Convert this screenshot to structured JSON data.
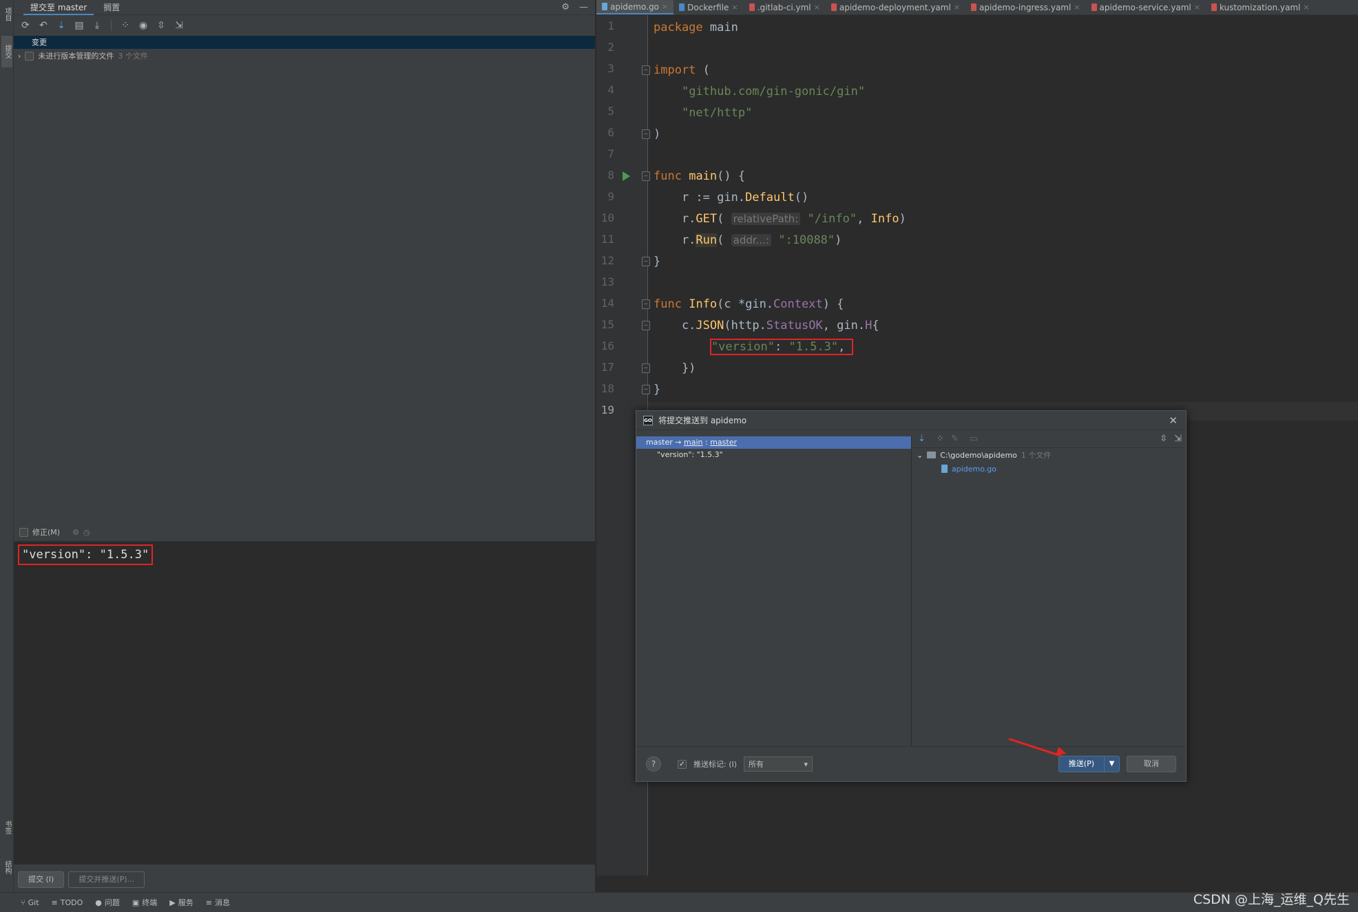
{
  "left_strip": {
    "top_tab": "项目",
    "commit_tab": "提交",
    "bookmarks_tab": "书签",
    "structure_tab": "结构"
  },
  "commit_panel": {
    "tabs": [
      "提交至 master",
      "搁置"
    ],
    "changes_header": "变更",
    "unversioned_label": "未进行版本管理的文件",
    "unversioned_count": "3 个文件",
    "amend_label": "修正(M)",
    "message": "\"version\": \"1.5.3\"",
    "commit_button": "提交 (I)",
    "commit_push_button": "提交并推送(P)..."
  },
  "editor": {
    "tabs": [
      {
        "label": "apidemo.go",
        "active": true
      },
      {
        "label": "Dockerfile",
        "active": false
      },
      {
        "label": ".gitlab-ci.yml",
        "active": false
      },
      {
        "label": "apidemo-deployment.yaml",
        "active": false
      },
      {
        "label": "apidemo-ingress.yaml",
        "active": false
      },
      {
        "label": "apidemo-service.yaml",
        "active": false
      },
      {
        "label": "kustomization.yaml",
        "active": false
      }
    ],
    "line_numbers": [
      "1",
      "2",
      "3",
      "4",
      "5",
      "6",
      "7",
      "8",
      "9",
      "10",
      "11",
      "12",
      "13",
      "14",
      "15",
      "16",
      "17",
      "18",
      "19"
    ],
    "hints": {
      "relative_path": "relativePath:",
      "addr": "addr...:"
    }
  },
  "dialog": {
    "title": "将提交推送到 apidemo",
    "branch_source": "master",
    "branch_arrow": "→",
    "branch_remote": "main",
    "branch_sep": ":",
    "branch_target": "master",
    "commit_message": "\"version\": \"1.5.3\"",
    "repo_path": "C:\\godemo\\apidemo",
    "repo_file_count": "1 个文件",
    "file": "apidemo.go",
    "push_tags_label": "推送标记: (I)",
    "push_tags_value": "所有",
    "push_button": "推送(P)",
    "cancel_button": "取消",
    "help": "?"
  },
  "status_bar": {
    "items": [
      "Git",
      "TODO",
      "问题",
      "终端",
      "服务",
      "消息"
    ]
  },
  "watermark": "CSDN @上海_运维_Q先生"
}
